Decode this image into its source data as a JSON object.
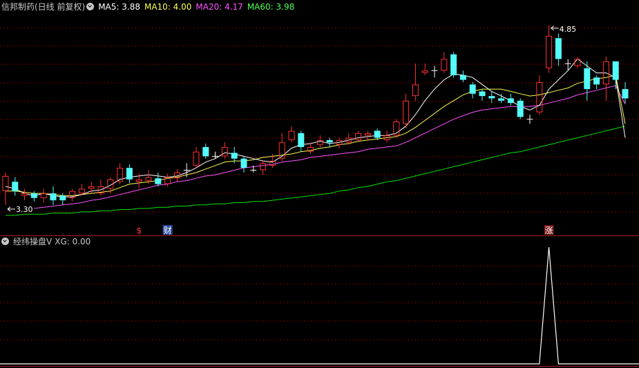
{
  "header": {
    "stock_title": "信邦制药(日线 前复权)",
    "ma5_label": "MA5: 3.88",
    "ma10_label": "MA10: 4.00",
    "ma20_label": "MA20: 4.17",
    "ma60_label": "MA60: 3.98"
  },
  "indicator": {
    "title": "经纬操盘V",
    "xg_label": "XG: 0.00"
  },
  "colors": {
    "up": "#ff3232",
    "down": "#54fcfc",
    "ma5": "#ffffff",
    "ma10": "#ffff54",
    "ma20": "#ff54ff",
    "ma60": "#00e600",
    "grid": "#7a0000",
    "title_text": "#c8c8c8",
    "xg_line": "#ffffff"
  },
  "chart_data": [
    {
      "type": "candlestick",
      "ylim": [
        3.15,
        4.95
      ],
      "annotations": {
        "high_label": "4.85",
        "low_label": "3.30"
      },
      "candles": [
        [
          3.42,
          3.55,
          3.58,
          3.3
        ],
        [
          3.5,
          3.42,
          3.54,
          3.38
        ],
        [
          3.38,
          3.4,
          3.44,
          3.34
        ],
        [
          3.4,
          3.36,
          3.42,
          3.33
        ],
        [
          3.36,
          3.4,
          3.44,
          3.32
        ],
        [
          3.4,
          3.34,
          3.46,
          3.3
        ],
        [
          3.38,
          3.34,
          3.4,
          3.3
        ],
        [
          3.36,
          3.42,
          3.44,
          3.33
        ],
        [
          3.4,
          3.44,
          3.48,
          3.38
        ],
        [
          3.44,
          3.46,
          3.5,
          3.4
        ],
        [
          3.4,
          3.46,
          3.52,
          3.38
        ],
        [
          3.44,
          3.52,
          3.54,
          3.4
        ],
        [
          3.5,
          3.62,
          3.66,
          3.48
        ],
        [
          3.62,
          3.52,
          3.65,
          3.49
        ],
        [
          3.5,
          3.52,
          3.57,
          3.44
        ],
        [
          3.51,
          3.54,
          3.6,
          3.48
        ],
        [
          3.53,
          3.48,
          3.58,
          3.46
        ],
        [
          3.48,
          3.54,
          3.57,
          3.46
        ],
        [
          3.53,
          3.58,
          3.61,
          3.5
        ],
        [
          3.6,
          3.6,
          3.66,
          3.54
        ],
        [
          3.64,
          3.76,
          3.8,
          3.62
        ],
        [
          3.8,
          3.72,
          3.83,
          3.7
        ],
        [
          3.72,
          3.72,
          3.76,
          3.7
        ],
        [
          3.72,
          3.8,
          3.84,
          3.7
        ],
        [
          3.75,
          3.7,
          3.8,
          3.66
        ],
        [
          3.7,
          3.62,
          3.72,
          3.58
        ],
        [
          3.6,
          3.6,
          3.64,
          3.58
        ],
        [
          3.6,
          3.66,
          3.68,
          3.56
        ],
        [
          3.64,
          3.68,
          3.74,
          3.62
        ],
        [
          3.7,
          3.84,
          3.92,
          3.68
        ],
        [
          3.86,
          3.94,
          3.98,
          3.84
        ],
        [
          3.92,
          3.8,
          3.94,
          3.76
        ],
        [
          3.76,
          3.8,
          3.84,
          3.74
        ],
        [
          3.82,
          3.86,
          3.9,
          3.8
        ],
        [
          3.86,
          3.84,
          3.88,
          3.8
        ],
        [
          3.82,
          3.86,
          3.88,
          3.79
        ],
        [
          3.84,
          3.88,
          3.92,
          3.82
        ],
        [
          3.86,
          3.92,
          3.94,
          3.84
        ],
        [
          3.9,
          3.92,
          3.94,
          3.86
        ],
        [
          3.94,
          3.88,
          3.96,
          3.86
        ],
        [
          3.86,
          3.9,
          3.94,
          3.84
        ],
        [
          3.9,
          4.02,
          4.04,
          3.88
        ],
        [
          4.0,
          4.2,
          4.26,
          3.96
        ],
        [
          4.24,
          4.34,
          4.52,
          4.2
        ],
        [
          4.44,
          4.46,
          4.52,
          4.42
        ],
        [
          4.46,
          4.46,
          4.5,
          4.4
        ],
        [
          4.46,
          4.56,
          4.62,
          4.44
        ],
        [
          4.6,
          4.42,
          4.62,
          4.4
        ],
        [
          4.42,
          4.38,
          4.46,
          4.36
        ],
        [
          4.34,
          4.26,
          4.36,
          4.22
        ],
        [
          4.28,
          4.24,
          4.3,
          4.2
        ],
        [
          4.24,
          4.22,
          4.28,
          4.18
        ],
        [
          4.22,
          4.2,
          4.26,
          4.18
        ],
        [
          4.22,
          4.18,
          4.26,
          4.16
        ],
        [
          4.2,
          4.06,
          4.22,
          4.04
        ],
        [
          4.04,
          4.04,
          4.08,
          4.0
        ],
        [
          4.1,
          4.36,
          4.42,
          4.08
        ],
        [
          4.48,
          4.76,
          4.85,
          4.44
        ],
        [
          4.74,
          4.56,
          4.78,
          4.5
        ],
        [
          4.52,
          4.52,
          4.56,
          4.46
        ],
        [
          4.5,
          4.56,
          4.58,
          4.48
        ],
        [
          4.48,
          4.3,
          4.54,
          4.2
        ],
        [
          4.4,
          4.34,
          4.42,
          4.3
        ],
        [
          4.34,
          4.54,
          4.58,
          4.2
        ],
        [
          4.54,
          4.38,
          4.54,
          4.3
        ],
        [
          4.3,
          4.22,
          4.36,
          4.18
        ]
      ],
      "ma5": [
        3.46,
        3.44,
        3.4,
        3.38,
        3.4,
        3.38,
        3.37,
        3.37,
        3.39,
        3.42,
        3.43,
        3.47,
        3.52,
        3.54,
        3.55,
        3.56,
        3.55,
        3.54,
        3.55,
        3.58,
        3.62,
        3.67,
        3.7,
        3.75,
        3.74,
        3.72,
        3.7,
        3.68,
        3.67,
        3.72,
        3.79,
        3.82,
        3.83,
        3.85,
        3.83,
        3.84,
        3.86,
        3.88,
        3.89,
        3.9,
        3.9,
        3.92,
        3.98,
        4.08,
        4.2,
        4.3,
        4.38,
        4.43,
        4.42,
        4.4,
        4.34,
        4.28,
        4.24,
        4.2,
        4.15,
        4.12,
        4.16,
        4.3,
        4.38,
        4.46,
        4.56,
        4.5,
        4.44,
        4.44,
        4.4,
        3.88
      ],
      "ma10": [
        3.42,
        3.42,
        3.41,
        3.4,
        3.4,
        3.39,
        3.38,
        3.38,
        3.39,
        3.4,
        3.41,
        3.42,
        3.45,
        3.48,
        3.49,
        3.5,
        3.51,
        3.53,
        3.54,
        3.56,
        3.58,
        3.61,
        3.64,
        3.67,
        3.68,
        3.68,
        3.69,
        3.71,
        3.72,
        3.73,
        3.74,
        3.76,
        3.77,
        3.79,
        3.8,
        3.82,
        3.83,
        3.85,
        3.86,
        3.87,
        3.88,
        3.89,
        3.92,
        3.97,
        4.03,
        4.09,
        4.15,
        4.2,
        4.25,
        4.28,
        4.3,
        4.3,
        4.3,
        4.28,
        4.26,
        4.24,
        4.25,
        4.27,
        4.29,
        4.31,
        4.35,
        4.37,
        4.39,
        4.4,
        4.42,
        4.0
      ],
      "ma20": [
        null,
        null,
        null,
        3.27,
        3.28,
        3.29,
        3.3,
        3.31,
        3.32,
        3.34,
        3.35,
        3.37,
        3.39,
        3.41,
        3.43,
        3.45,
        3.47,
        3.48,
        3.5,
        3.51,
        3.53,
        3.55,
        3.56,
        3.58,
        3.6,
        3.62,
        3.63,
        3.64,
        3.65,
        3.67,
        3.68,
        3.69,
        3.71,
        3.72,
        3.73,
        3.74,
        3.75,
        3.76,
        3.78,
        3.79,
        3.8,
        3.81,
        3.84,
        3.88,
        3.92,
        3.96,
        4.0,
        4.04,
        4.07,
        4.1,
        4.12,
        4.13,
        4.14,
        4.15,
        4.15,
        4.15,
        4.16,
        4.18,
        4.2,
        4.22,
        4.25,
        4.27,
        4.29,
        4.31,
        4.33,
        4.17
      ],
      "ma60": [
        3.21,
        3.21,
        3.22,
        3.22,
        3.22,
        3.23,
        3.23,
        3.23,
        3.24,
        3.24,
        3.25,
        3.25,
        3.26,
        3.26,
        3.27,
        3.27,
        3.28,
        3.28,
        3.29,
        3.29,
        3.3,
        3.3,
        3.31,
        3.31,
        3.32,
        3.32,
        3.33,
        3.33,
        3.34,
        3.35,
        3.36,
        3.37,
        3.38,
        3.39,
        3.4,
        3.42,
        3.43,
        3.45,
        3.46,
        3.48,
        3.5,
        3.51,
        3.53,
        3.55,
        3.57,
        3.59,
        3.61,
        3.63,
        3.65,
        3.67,
        3.69,
        3.71,
        3.73,
        3.75,
        3.76,
        3.78,
        3.8,
        3.82,
        3.84,
        3.86,
        3.88,
        3.9,
        3.92,
        3.94,
        3.96,
        3.98
      ]
    },
    {
      "type": "line",
      "name": "XG",
      "ylim": [
        0,
        1
      ],
      "values": [
        0,
        0,
        0,
        0,
        0,
        0,
        0,
        0,
        0,
        0,
        0,
        0,
        0,
        0,
        0,
        0,
        0,
        0,
        0,
        0,
        0,
        0,
        0,
        0,
        0,
        0,
        0,
        0,
        0,
        0,
        0,
        0,
        0,
        0,
        0,
        0,
        0,
        0,
        0,
        0,
        0,
        0,
        0,
        0,
        0,
        0,
        0,
        0,
        0,
        0,
        0,
        0,
        0,
        0,
        0,
        0,
        0,
        1,
        0,
        0,
        0,
        0,
        0,
        0,
        0,
        0
      ]
    }
  ],
  "markers": [
    {
      "label": "$",
      "index": 14,
      "color": "#ff3232",
      "box": false
    },
    {
      "label": "财",
      "index": 17,
      "color": "#ffffff",
      "box": true,
      "box_color": "#2b4a9c"
    },
    {
      "label": "涨",
      "index": 57,
      "color": "#ffffff",
      "box": true,
      "box_color": "#7a1a1a"
    }
  ]
}
